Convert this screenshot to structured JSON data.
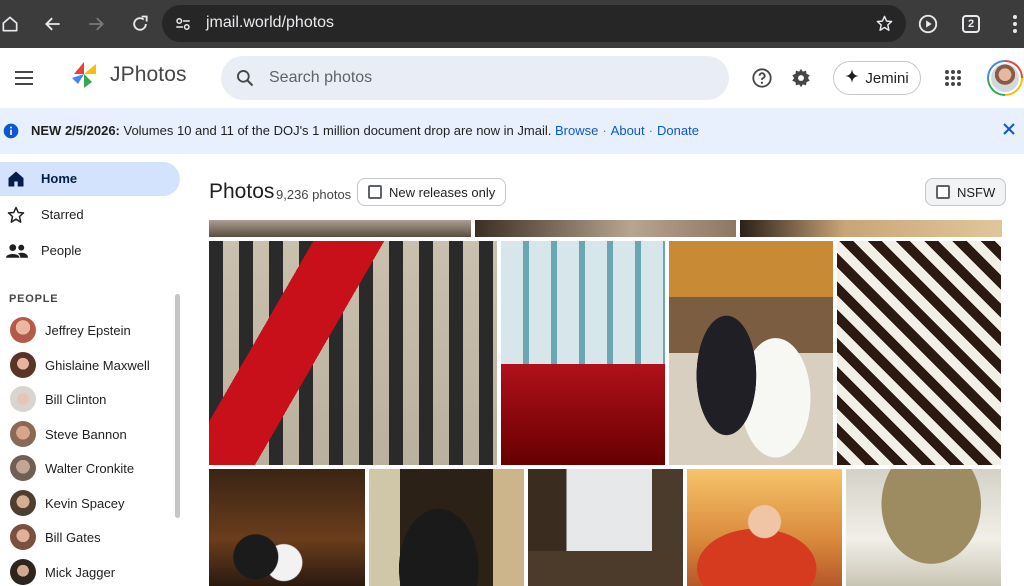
{
  "browser": {
    "url": "jmail.world/photos",
    "tab_count": "2"
  },
  "app": {
    "brand": "JPhotos",
    "search_placeholder": "Search photos",
    "jemini_label": "Jemini"
  },
  "banner": {
    "prefix": "NEW 2/5/2026:",
    "message": " Volumes 10 and 11 of the DOJ's 1 million document drop are now in Jmail.",
    "browse": "Browse",
    "about": "About",
    "donate": "Donate",
    "separator": "·"
  },
  "sidebar": {
    "nav": [
      {
        "label": "Home",
        "icon": "home-icon",
        "active": true
      },
      {
        "label": "Starred",
        "icon": "star-icon",
        "active": false
      },
      {
        "label": "People",
        "icon": "people-icon",
        "active": false
      }
    ],
    "section_title": "PEOPLE",
    "people": [
      {
        "name": "Jeffrey Epstein",
        "color": "#b55a4a"
      },
      {
        "name": "Ghislaine Maxwell",
        "color": "#7a4a3a"
      },
      {
        "name": "Bill Clinton",
        "color": "#c9b9b0"
      },
      {
        "name": "Steve Bannon",
        "color": "#a8826a"
      },
      {
        "name": "Walter Cronkite",
        "color": "#8a7a70"
      },
      {
        "name": "Kevin Spacey",
        "color": "#6a5a4a"
      },
      {
        "name": "Bill Gates",
        "color": "#9a7060"
      },
      {
        "name": "Mick Jagger",
        "color": "#4a3a30"
      }
    ]
  },
  "main": {
    "title": "Photos",
    "count": "9,236 photos",
    "new_releases_label": "New releases only",
    "nsfw_label": "NSFW"
  },
  "colors": {
    "banner_bg": "#e8f0fe",
    "link": "#0b57d0",
    "active_nav": "#d3e3fd",
    "chrome": "#3c3c3c"
  }
}
